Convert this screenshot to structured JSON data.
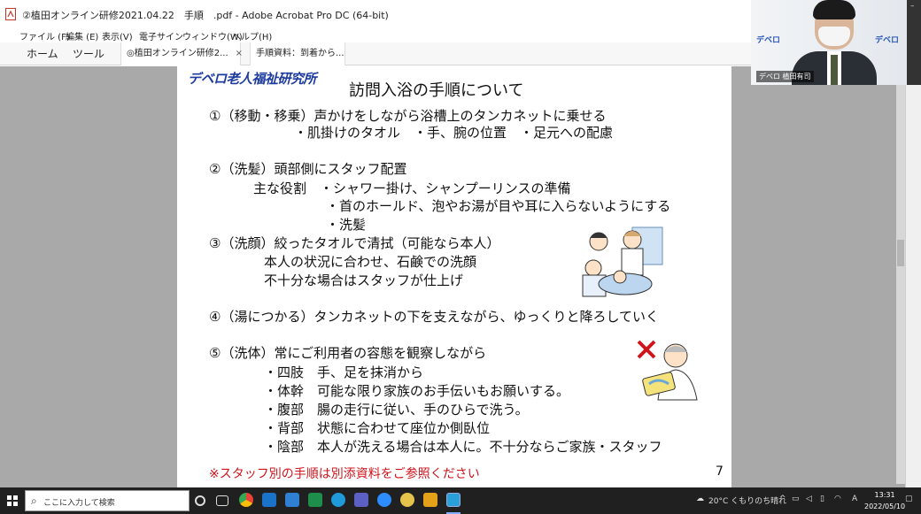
{
  "window": {
    "title": "②植田オンライン研修2021.04.22　手順　.pdf - Adobe Acrobat Pro DC (64-bit)"
  },
  "menu": {
    "items": [
      "ファイル (F)",
      "編集 (E)",
      "表示(V)",
      "電子サイン",
      "ウィンドウ(W)",
      "ヘルプ(H)"
    ]
  },
  "tabs": {
    "home": "ホーム",
    "tools": "ツール",
    "doc1": "◎植田オンライン研修2...",
    "doc1_close": "×",
    "doc2": "手順資料：到着から..."
  },
  "slide": {
    "brand": "デベロ老人福祉研究所",
    "title": "訪問入浴の手順について",
    "lines": [
      "①（移動・移乗）声かけをしながら浴槽上のタンカネットに乗せる",
      "・肌掛けのタオル　・手、腕の位置　・足元への配慮",
      "②（洗髪）頭部側にスタッフ配置",
      "主な役割　・シャワー掛け、シャンプーリンスの準備",
      "・首のホールド、泡やお湯が目や耳に入らないようにする",
      "・洗髪",
      "③（洗顔）絞ったタオルで清拭（可能なら本人）",
      "本人の状況に合わせ、石鹸での洗顔",
      "不十分な場合はスタッフが仕上げ",
      "④（湯につかる）タンカネットの下を支えながら、ゆっくりと降ろしていく",
      "⑤（洗体）常にご利用者の容態を観察しながら",
      "・四肢　手、足を抹消から",
      "・体幹　可能な限り家族のお手伝いもお願いする。",
      "・腹部　腸の走行に従い、手のひらで洗う。",
      "・背部　状態に合わせて座位か側臥位",
      "・陰部　本人が洗える場合は本人に。不十分ならご家族・スタッフ"
    ],
    "note": "※スタッフ別の手順は別添資料をご参照ください",
    "page_number": "7"
  },
  "webcam": {
    "participant_name": "デベロ 植田有司",
    "wall_text": "デベロ"
  },
  "taskbar": {
    "search_placeholder": "ここに入力して検索",
    "weather": "20°C くもりのち晴れ",
    "ime": "A",
    "time": "13:31",
    "date": "2022/05/10"
  },
  "colors": {
    "brand_blue": "#1d3b9e",
    "note_red": "#d0141c",
    "taskbar": "#202020"
  }
}
